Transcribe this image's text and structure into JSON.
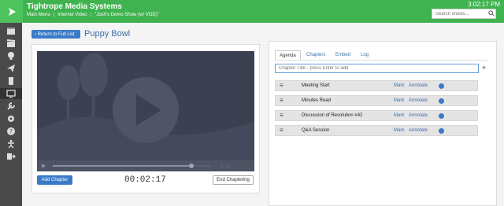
{
  "header": {
    "app_title": "Tightrope Media Systems",
    "breadcrumbs": [
      "Main Menu",
      "Internet Video",
      "\"Josh's Demo Show (w/ VOD)\""
    ],
    "clock": "3:02:17 PM",
    "search_placeholder": "Search shows..."
  },
  "sidebar": {
    "icons": [
      "calendar-icon",
      "clapper-icon",
      "lightbulb-icon",
      "send-icon",
      "phone-icon",
      "monitor-icon",
      "wrench-icon",
      "gear-icon",
      "question-icon",
      "person-icon",
      "logout-icon"
    ],
    "active_index": 5
  },
  "page": {
    "back_label": "Return to Full List",
    "title": "Puppy Bowl"
  },
  "player": {
    "progress_fraction": 0.88,
    "duration": "4:32",
    "add_chapter_label": "Add Chapter",
    "timecode": "00:02:17",
    "end_chapter_label": "End Chaptering"
  },
  "tabs": [
    "Agenda",
    "Chapters",
    "Embed",
    "Log"
  ],
  "chapter_input_placeholder": "Chapter Title - press Enter to add",
  "agenda_items": [
    {
      "label": "Meeting Start",
      "mark": "Mark",
      "annotate": "Annotate"
    },
    {
      "label": "Minutes Read",
      "mark": "Mark",
      "annotate": "Annotate"
    },
    {
      "label": "Discussion of Resolution #42",
      "mark": "Mark",
      "annotate": "Annotate"
    },
    {
      "label": "Q&A Session",
      "mark": "Mark",
      "annotate": "Annotate"
    }
  ],
  "colors": {
    "header_green": "#3fb34f",
    "sidebar": "#4a4a4a",
    "accent_blue": "#3a7bc8"
  }
}
